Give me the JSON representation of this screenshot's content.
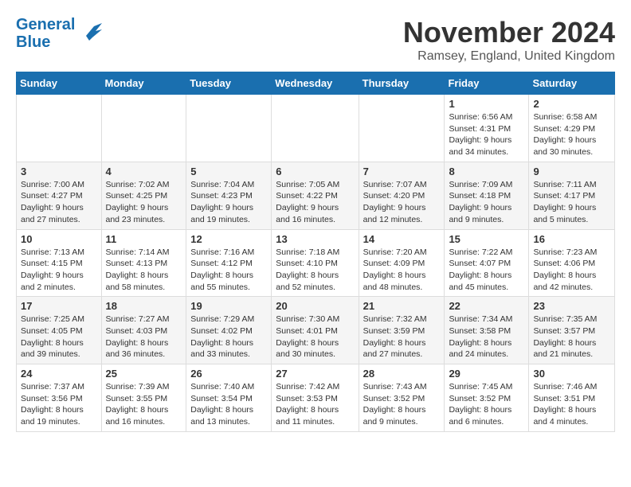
{
  "logo": {
    "line1": "General",
    "line2": "Blue"
  },
  "title": "November 2024",
  "location": "Ramsey, England, United Kingdom",
  "weekdays": [
    "Sunday",
    "Monday",
    "Tuesday",
    "Wednesday",
    "Thursday",
    "Friday",
    "Saturday"
  ],
  "weeks": [
    [
      {
        "day": "",
        "info": ""
      },
      {
        "day": "",
        "info": ""
      },
      {
        "day": "",
        "info": ""
      },
      {
        "day": "",
        "info": ""
      },
      {
        "day": "",
        "info": ""
      },
      {
        "day": "1",
        "info": "Sunrise: 6:56 AM\nSunset: 4:31 PM\nDaylight: 9 hours\nand 34 minutes."
      },
      {
        "day": "2",
        "info": "Sunrise: 6:58 AM\nSunset: 4:29 PM\nDaylight: 9 hours\nand 30 minutes."
      }
    ],
    [
      {
        "day": "3",
        "info": "Sunrise: 7:00 AM\nSunset: 4:27 PM\nDaylight: 9 hours\nand 27 minutes."
      },
      {
        "day": "4",
        "info": "Sunrise: 7:02 AM\nSunset: 4:25 PM\nDaylight: 9 hours\nand 23 minutes."
      },
      {
        "day": "5",
        "info": "Sunrise: 7:04 AM\nSunset: 4:23 PM\nDaylight: 9 hours\nand 19 minutes."
      },
      {
        "day": "6",
        "info": "Sunrise: 7:05 AM\nSunset: 4:22 PM\nDaylight: 9 hours\nand 16 minutes."
      },
      {
        "day": "7",
        "info": "Sunrise: 7:07 AM\nSunset: 4:20 PM\nDaylight: 9 hours\nand 12 minutes."
      },
      {
        "day": "8",
        "info": "Sunrise: 7:09 AM\nSunset: 4:18 PM\nDaylight: 9 hours\nand 9 minutes."
      },
      {
        "day": "9",
        "info": "Sunrise: 7:11 AM\nSunset: 4:17 PM\nDaylight: 9 hours\nand 5 minutes."
      }
    ],
    [
      {
        "day": "10",
        "info": "Sunrise: 7:13 AM\nSunset: 4:15 PM\nDaylight: 9 hours\nand 2 minutes."
      },
      {
        "day": "11",
        "info": "Sunrise: 7:14 AM\nSunset: 4:13 PM\nDaylight: 8 hours\nand 58 minutes."
      },
      {
        "day": "12",
        "info": "Sunrise: 7:16 AM\nSunset: 4:12 PM\nDaylight: 8 hours\nand 55 minutes."
      },
      {
        "day": "13",
        "info": "Sunrise: 7:18 AM\nSunset: 4:10 PM\nDaylight: 8 hours\nand 52 minutes."
      },
      {
        "day": "14",
        "info": "Sunrise: 7:20 AM\nSunset: 4:09 PM\nDaylight: 8 hours\nand 48 minutes."
      },
      {
        "day": "15",
        "info": "Sunrise: 7:22 AM\nSunset: 4:07 PM\nDaylight: 8 hours\nand 45 minutes."
      },
      {
        "day": "16",
        "info": "Sunrise: 7:23 AM\nSunset: 4:06 PM\nDaylight: 8 hours\nand 42 minutes."
      }
    ],
    [
      {
        "day": "17",
        "info": "Sunrise: 7:25 AM\nSunset: 4:05 PM\nDaylight: 8 hours\nand 39 minutes."
      },
      {
        "day": "18",
        "info": "Sunrise: 7:27 AM\nSunset: 4:03 PM\nDaylight: 8 hours\nand 36 minutes."
      },
      {
        "day": "19",
        "info": "Sunrise: 7:29 AM\nSunset: 4:02 PM\nDaylight: 8 hours\nand 33 minutes."
      },
      {
        "day": "20",
        "info": "Sunrise: 7:30 AM\nSunset: 4:01 PM\nDaylight: 8 hours\nand 30 minutes."
      },
      {
        "day": "21",
        "info": "Sunrise: 7:32 AM\nSunset: 3:59 PM\nDaylight: 8 hours\nand 27 minutes."
      },
      {
        "day": "22",
        "info": "Sunrise: 7:34 AM\nSunset: 3:58 PM\nDaylight: 8 hours\nand 24 minutes."
      },
      {
        "day": "23",
        "info": "Sunrise: 7:35 AM\nSunset: 3:57 PM\nDaylight: 8 hours\nand 21 minutes."
      }
    ],
    [
      {
        "day": "24",
        "info": "Sunrise: 7:37 AM\nSunset: 3:56 PM\nDaylight: 8 hours\nand 19 minutes."
      },
      {
        "day": "25",
        "info": "Sunrise: 7:39 AM\nSunset: 3:55 PM\nDaylight: 8 hours\nand 16 minutes."
      },
      {
        "day": "26",
        "info": "Sunrise: 7:40 AM\nSunset: 3:54 PM\nDaylight: 8 hours\nand 13 minutes."
      },
      {
        "day": "27",
        "info": "Sunrise: 7:42 AM\nSunset: 3:53 PM\nDaylight: 8 hours\nand 11 minutes."
      },
      {
        "day": "28",
        "info": "Sunrise: 7:43 AM\nSunset: 3:52 PM\nDaylight: 8 hours\nand 9 minutes."
      },
      {
        "day": "29",
        "info": "Sunrise: 7:45 AM\nSunset: 3:52 PM\nDaylight: 8 hours\nand 6 minutes."
      },
      {
        "day": "30",
        "info": "Sunrise: 7:46 AM\nSunset: 3:51 PM\nDaylight: 8 hours\nand 4 minutes."
      }
    ]
  ]
}
